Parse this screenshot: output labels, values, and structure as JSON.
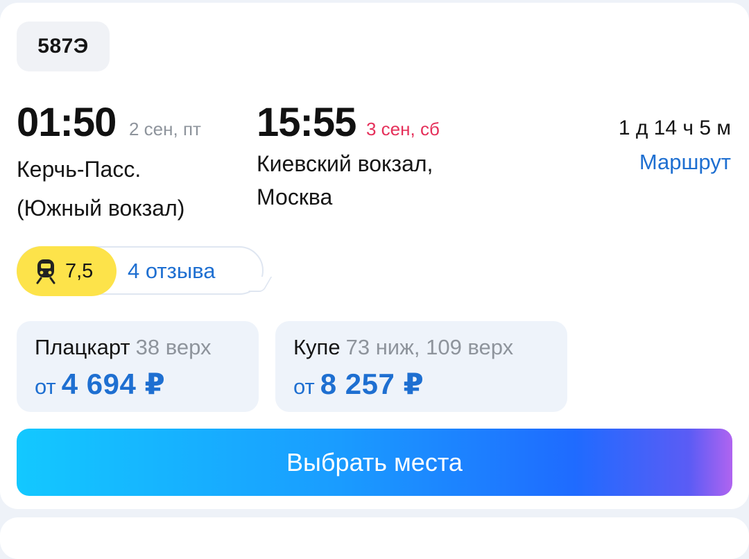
{
  "train": {
    "number": "587Э"
  },
  "departure": {
    "time": "01:50",
    "date": "2 сен, пт",
    "station_line1": "Керчь-Пасс.",
    "station_line2": "(Южный вокзал)"
  },
  "arrival": {
    "time": "15:55",
    "date": "3 сен, сб",
    "station_line1": "Киевский вокзал,",
    "station_line2": "Москва"
  },
  "trip": {
    "duration": "1 д 14 ч 5 м",
    "route_link": "Маршрут"
  },
  "rating": {
    "score": "7,5",
    "reviews_link": "4 отзыва",
    "icon": "train-icon"
  },
  "fares": [
    {
      "class": "Плацкарт",
      "seats": "38 верх",
      "from": "от",
      "price": "4 694 ₽"
    },
    {
      "class": "Купе",
      "seats": "73 ниж, 109 верх",
      "from": "от",
      "price": "8 257 ₽"
    }
  ],
  "cta": {
    "label": "Выбрать места"
  },
  "colors": {
    "accent": "#1e6fd1",
    "arrival_date": "#e5305a",
    "rating_badge": "#fde34a",
    "fare_bg": "#eef3fa"
  }
}
